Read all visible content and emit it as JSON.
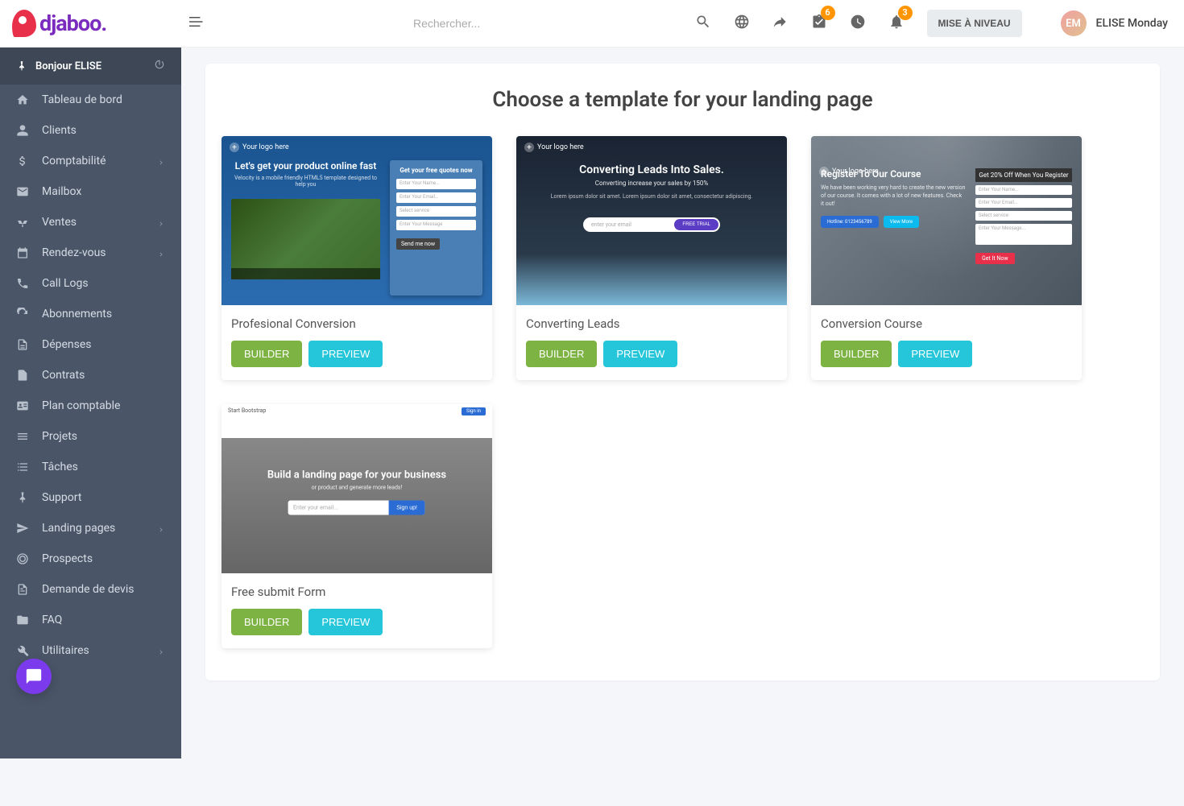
{
  "brand": "djaboo.",
  "search": {
    "placeholder": "Rechercher..."
  },
  "topbar": {
    "check_badge": "6",
    "bell_badge": "3",
    "upgrade": "MISE À NIVEAU",
    "user_name": "ELISE Monday",
    "avatar_initials": "EM"
  },
  "sidebar": {
    "greeting": "Bonjour ELISE",
    "items": [
      {
        "id": "dashboard",
        "label": "Tableau de bord",
        "icon": "home",
        "chevron": false
      },
      {
        "id": "clients",
        "label": "Clients",
        "icon": "user",
        "chevron": false
      },
      {
        "id": "accounting",
        "label": "Comptabilité",
        "icon": "dollar",
        "chevron": true
      },
      {
        "id": "mailbox",
        "label": "Mailbox",
        "icon": "mail",
        "chevron": false
      },
      {
        "id": "sales",
        "label": "Ventes",
        "icon": "scale",
        "chevron": true
      },
      {
        "id": "appointments",
        "label": "Rendez-vous",
        "icon": "calendar",
        "chevron": true
      },
      {
        "id": "calllogs",
        "label": "Call Logs",
        "icon": "phone",
        "chevron": false
      },
      {
        "id": "subscriptions",
        "label": "Abonnements",
        "icon": "refresh",
        "chevron": false
      },
      {
        "id": "expenses",
        "label": "Dépenses",
        "icon": "filetext",
        "chevron": false
      },
      {
        "id": "contracts",
        "label": "Contrats",
        "icon": "file",
        "chevron": false
      },
      {
        "id": "chart",
        "label": "Plan comptable",
        "icon": "idcard",
        "chevron": false
      },
      {
        "id": "projects",
        "label": "Projets",
        "icon": "bars",
        "chevron": false
      },
      {
        "id": "tasks",
        "label": "Tâches",
        "icon": "tasks",
        "chevron": false
      },
      {
        "id": "support",
        "label": "Support",
        "icon": "pin",
        "chevron": false
      },
      {
        "id": "landing",
        "label": "Landing pages",
        "icon": "send",
        "chevron": true
      },
      {
        "id": "prospects",
        "label": "Prospects",
        "icon": "target",
        "chevron": false
      },
      {
        "id": "quotes",
        "label": "Demande de devis",
        "icon": "filelines",
        "chevron": false
      },
      {
        "id": "faq",
        "label": "FAQ",
        "icon": "folder",
        "chevron": false
      },
      {
        "id": "utilities",
        "label": "Utilitaires",
        "icon": "wrench",
        "chevron": true
      }
    ]
  },
  "main": {
    "title": "Choose a template for your landing page",
    "builder_label": "BUILDER",
    "preview_label": "PREVIEW",
    "templates": [
      {
        "name": "Profesional Conversion"
      },
      {
        "name": "Converting Leads"
      },
      {
        "name": "Conversion Course"
      },
      {
        "name": "Free submit Form"
      }
    ],
    "thumb1": {
      "logo": "Your logo here",
      "headline": "Let's get your product online fast",
      "sub": "Velocity is a mobile friendly HTML5 template designed to help you",
      "form_title": "Get your free quotes now",
      "field1": "Enter Your Name...",
      "field2": "Enter Your Email...",
      "field3": "Select service",
      "field4": "Enter Your Message",
      "btn": "Send me now"
    },
    "thumb2": {
      "logo": "Your logo here",
      "headline": "Converting Leads Into Sales.",
      "sub": "Converting increase your sales by 150%",
      "desc": "Lorem ipsum dolor sit amet. Lorem ipsum dolor sit amet, consectetur adipiscing.",
      "pill_placeholder": "enter your email",
      "pill_btn": "FREE TRIAL"
    },
    "thumb3": {
      "logo": "Your logo here",
      "headline": "Register To Our Course",
      "desc": "We have been working very hard to create the new version of our course. It comes with a lot of new features. Check it out!",
      "hotline": "Hotline: 0123456789",
      "viewmore": "View More",
      "form_title": "Get 20% Off When You Register",
      "field1": "Enter Your Name...",
      "field2": "Enter Your Email...",
      "field3": "Select service",
      "field4": "Enter Your Message...",
      "btn": "Get It Now"
    },
    "thumb4": {
      "brand": "Start Bootstrap",
      "signin": "Sign in",
      "headline": "Build a landing page for your business",
      "desc": "or product and generate more leads!",
      "input_placeholder": "Enter your email...",
      "btn": "Sign up!"
    }
  }
}
